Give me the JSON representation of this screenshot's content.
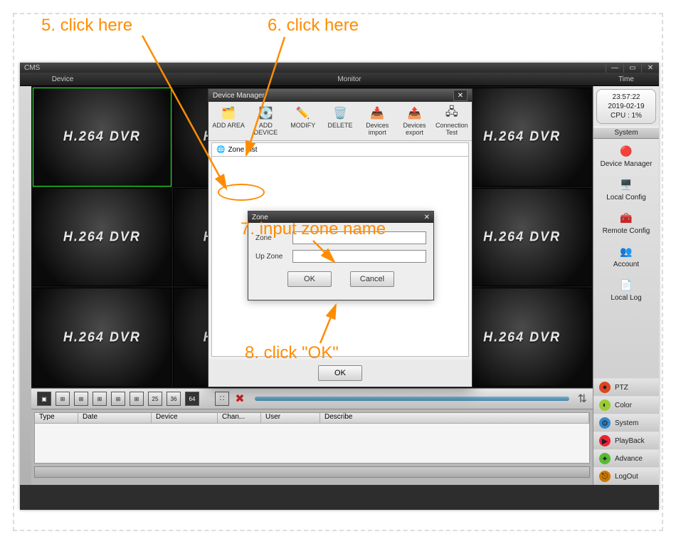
{
  "annotations": {
    "step5": "5. click here",
    "step6": "6. click here",
    "step7": "7. input zone name",
    "step8": "8. click \"OK\""
  },
  "app": {
    "title": "CMS",
    "header": {
      "device": "Device",
      "monitor": "Monitor",
      "time": "Time"
    },
    "clock": {
      "time": "23:57:22",
      "date": "2019-02-19",
      "cpu": "CPU : 1%"
    },
    "cell_label": "H.264 DVR",
    "system_title": "System",
    "sys_icons": [
      {
        "label": "Device Manager",
        "glyph": "🔴"
      },
      {
        "label": "Local Config",
        "glyph": "🖥️"
      },
      {
        "label": "Remote Config",
        "glyph": "🧰"
      },
      {
        "label": "Account",
        "glyph": "👥"
      },
      {
        "label": "Local Log",
        "glyph": "📄"
      }
    ],
    "right_btns": [
      {
        "label": "PTZ",
        "color": "#d42"
      },
      {
        "label": "Color",
        "color": "#9c3"
      },
      {
        "label": "System",
        "color": "#38c"
      },
      {
        "label": "PlayBack",
        "color": "#e23"
      },
      {
        "label": "Advance",
        "color": "#5b3"
      },
      {
        "label": "LogOut",
        "color": "#c70"
      }
    ],
    "log_cols": [
      "Type",
      "Date",
      "Device",
      "Chan...",
      "User",
      "Describe"
    ],
    "layouts": [
      "▣",
      "⊞",
      "⊞",
      "⊞",
      "⊞",
      "⊞",
      "25",
      "36",
      "64"
    ]
  },
  "dlg": {
    "title": "Device Manager",
    "tree_root": "Zone List",
    "buttons": [
      {
        "label": "ADD AREA",
        "glyph": "🗂️"
      },
      {
        "label": "ADD DEVICE",
        "glyph": "💽"
      },
      {
        "label": "MODIFY",
        "glyph": "✏️"
      },
      {
        "label": "DELETE",
        "glyph": "🗑️"
      },
      {
        "label": "Devices import",
        "glyph": "📥"
      },
      {
        "label": "Devices export",
        "glyph": "📤"
      },
      {
        "label": "Connection Test",
        "glyph": "🖧"
      }
    ],
    "ok": "OK"
  },
  "zone": {
    "title": "Zone",
    "label_zone": "Zone",
    "label_up": "Up Zone",
    "value_zone": "",
    "value_up": "",
    "ok": "OK",
    "cancel": "Cancel"
  }
}
